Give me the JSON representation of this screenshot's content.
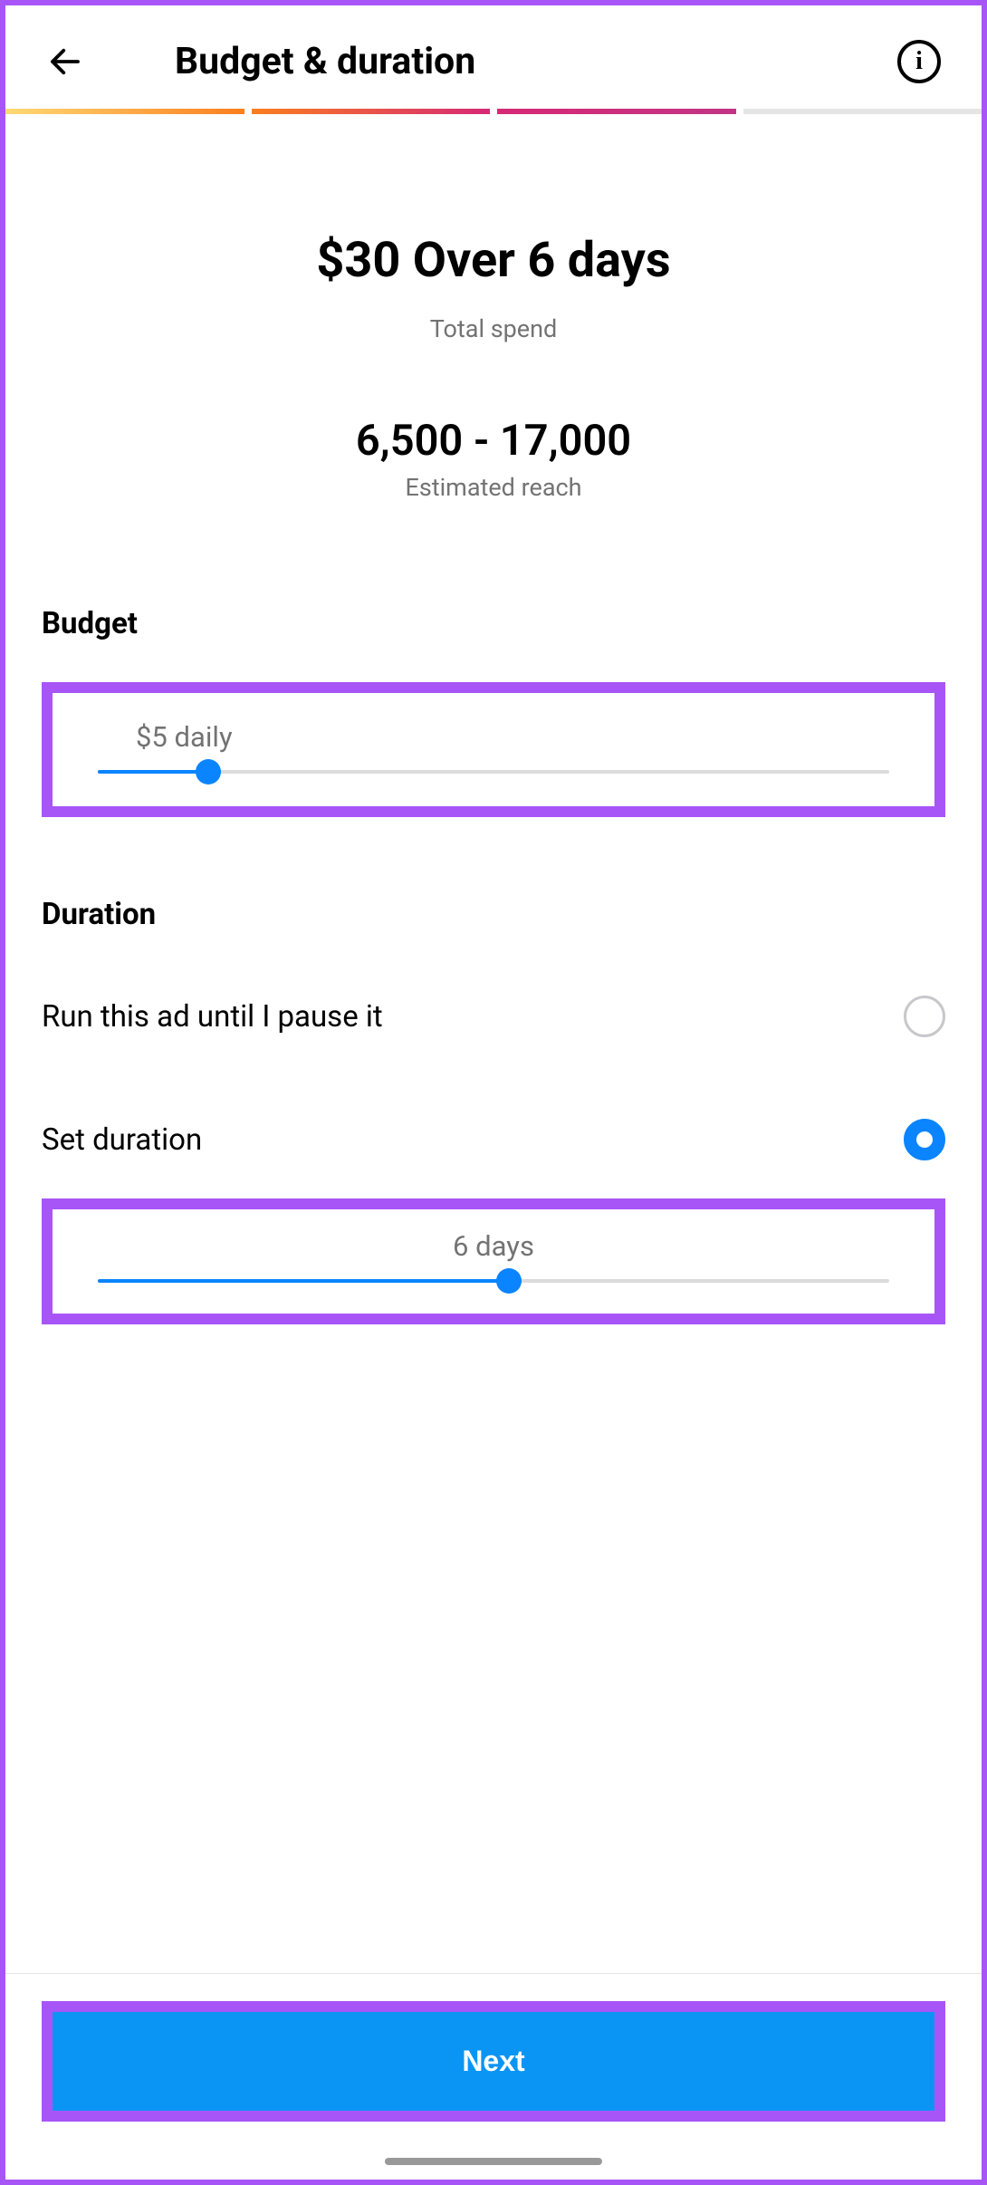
{
  "header": {
    "title": "Budget & duration"
  },
  "summary": {
    "headline": "$30 Over 6 days",
    "sublabel": "Total spend",
    "reach_value": "6,500 - 17,000",
    "reach_label": "Estimated reach"
  },
  "budget": {
    "section_label": "Budget",
    "slider_label": "$5 daily",
    "slider_percent": 14
  },
  "duration": {
    "section_label": "Duration",
    "option_pause": "Run this ad until I pause it",
    "option_set": "Set duration",
    "slider_label": "6 days",
    "slider_percent": 52
  },
  "footer": {
    "next": "Next"
  }
}
